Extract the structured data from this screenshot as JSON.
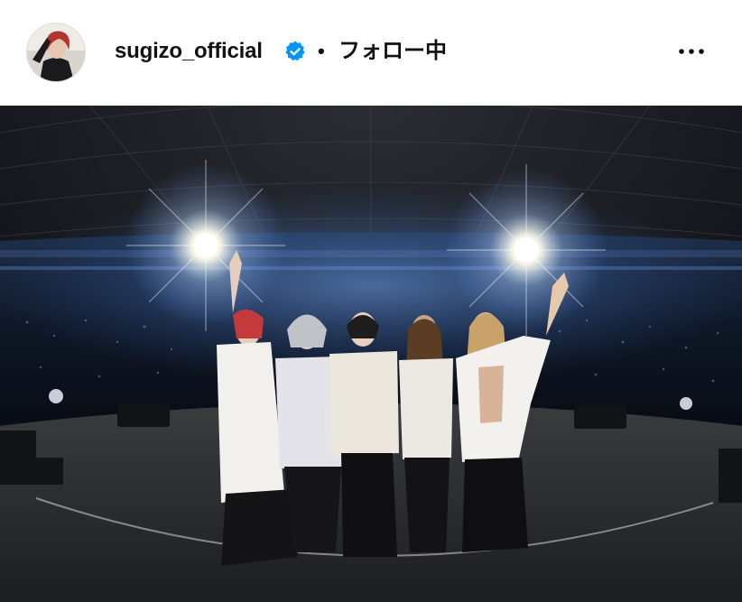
{
  "post": {
    "username": "sugizo_official",
    "verified_icon": "verified-badge-icon",
    "separator": "•",
    "follow_state": "フォロー中",
    "more_icon": "more-horizontal-icon"
  },
  "colors": {
    "verified_blue": "#0095f6",
    "text": "#111111",
    "background": "#ffffff"
  }
}
